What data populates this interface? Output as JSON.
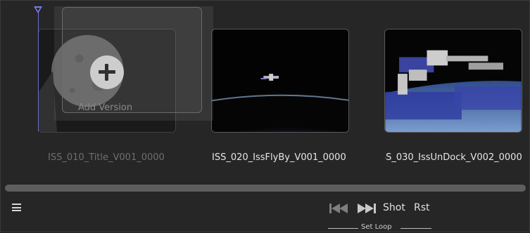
{
  "timeline": {
    "shots": [
      {
        "name": "ISS_010_Title_V001_0000",
        "state": "inactive"
      },
      {
        "name": "ISS_020_IssFlyBy_V001_0000",
        "state": "active"
      },
      {
        "name": "ISS_030_IssUnDock_V002_0000",
        "state": "active"
      }
    ],
    "add_version_label": "Add Version",
    "playhead_color": "#7a7af0"
  },
  "toolbar": {
    "menu_icon": "hamburger-menu-icon",
    "prev_icon": "skip-back-icon",
    "next_icon": "skip-forward-icon",
    "shot_label": "Shot",
    "rst_label": "Rst",
    "set_loop_label": "Set Loop"
  }
}
